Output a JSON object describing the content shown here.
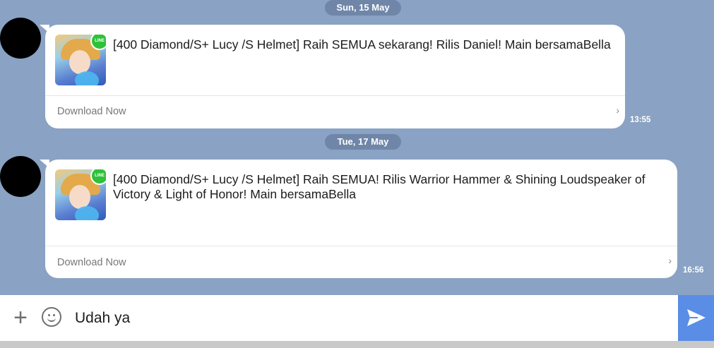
{
  "chat": {
    "messages": [
      {
        "date": "Sun, 15 May",
        "text": "[400 Diamond/S+ Lucy /S Helmet] Raih SEMUA sekarang! Rilis Daniel! Main bersamaBella",
        "action": "Download Now",
        "time": "13:55",
        "thumb_badge": "LINE"
      },
      {
        "date": "Tue, 17 May",
        "text": "[400 Diamond/S+ Lucy /S Helmet] Raih SEMUA! Rilis Warrior Hammer & Shining Loudspeaker of Victory & Light of Honor! Main bersamaBella",
        "action": "Download Now",
        "time": "16:56",
        "thumb_badge": "LINE"
      }
    ]
  },
  "input": {
    "value": "Udah ya"
  },
  "icons": {
    "plus": "plus-icon",
    "emoji": "smiley-icon",
    "send": "send-icon",
    "chevron": "chevron-right-icon"
  },
  "colors": {
    "background": "#8aa2c3",
    "send_button": "#5a8de6",
    "line_green": "#2fc13a"
  }
}
